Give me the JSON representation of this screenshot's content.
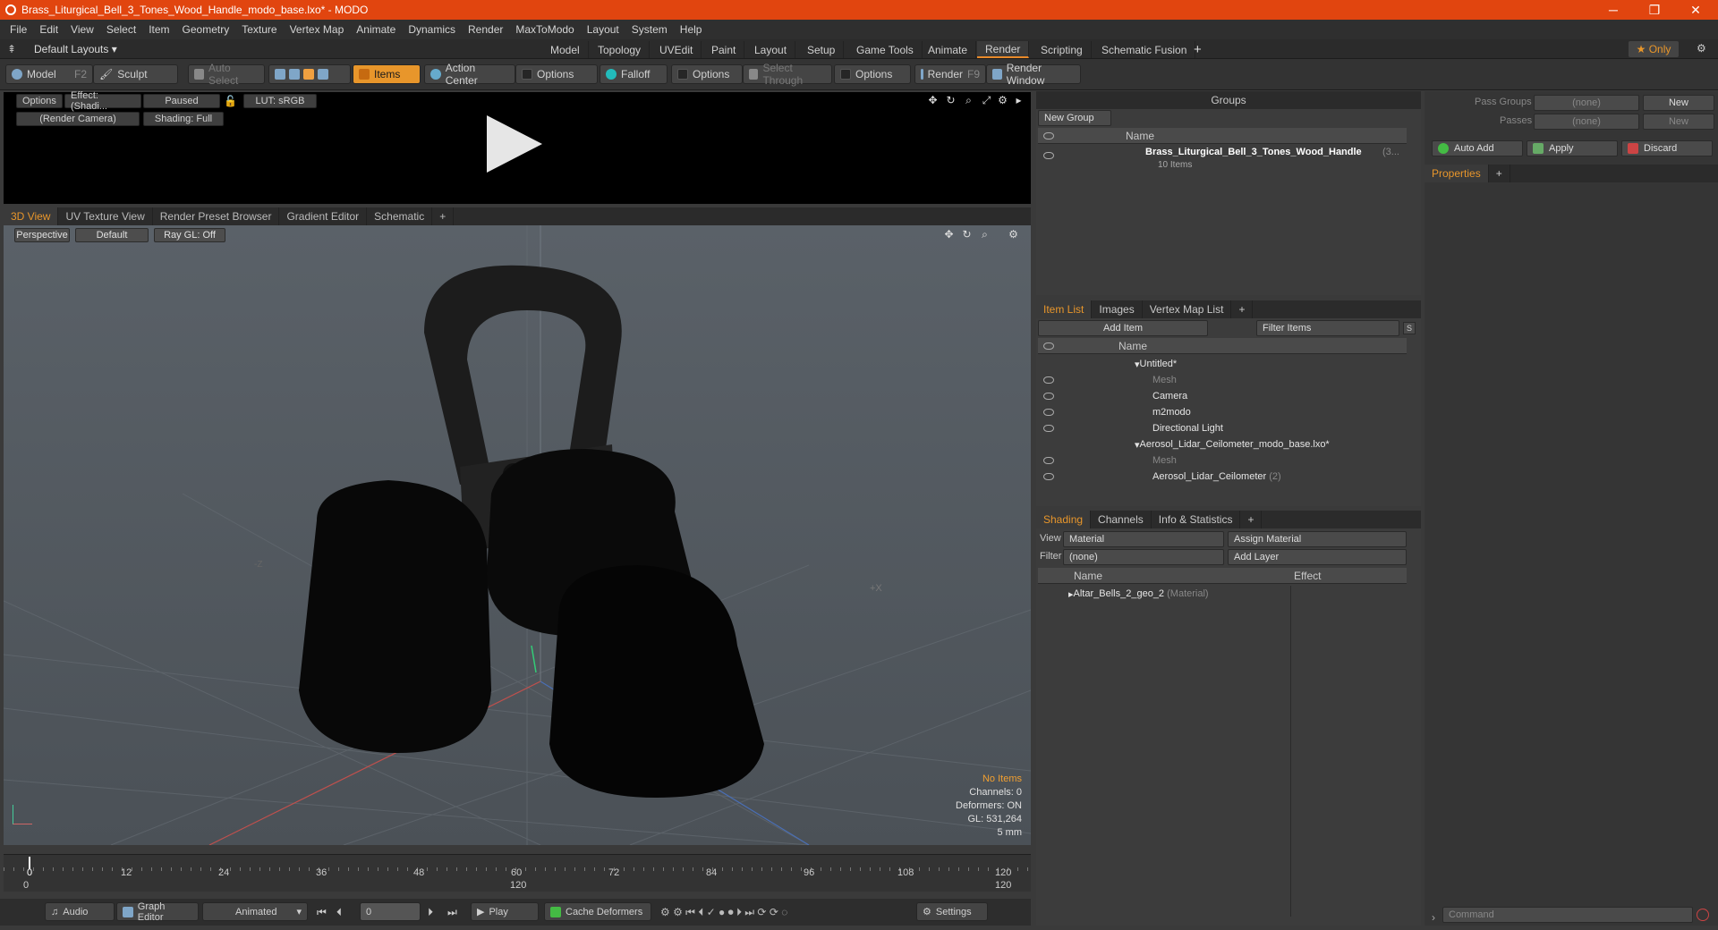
{
  "window": {
    "title": "Brass_Liturgical_Bell_3_Tones_Wood_Handle_modo_base.lxo* - MODO",
    "min": "─",
    "max": "❐",
    "close": "✕"
  },
  "menu": [
    "File",
    "Edit",
    "View",
    "Select",
    "Item",
    "Geometry",
    "Texture",
    "Vertex Map",
    "Animate",
    "Dynamics",
    "Render",
    "MaxToModo",
    "Layout",
    "System",
    "Help"
  ],
  "layouts": {
    "default_label": "Default Layouts ▾",
    "tabs": [
      "Model",
      "Topology",
      "UVEdit",
      "Paint",
      "Layout",
      "Setup",
      "Game Tools",
      "Animate",
      "Render",
      "Scripting",
      "Schematic Fusion"
    ],
    "active": "Render",
    "add": "+",
    "only": "★  Only"
  },
  "toolbar": {
    "model": "Model",
    "model_key": "F2",
    "sculpt": "Sculpt",
    "auto_select": "Auto Select",
    "items": "Items",
    "action_center": "Action Center",
    "options1": "Options",
    "falloff": "Falloff",
    "options2": "Options",
    "select_through": "Select Through",
    "options3": "Options",
    "render": "Render",
    "render_key": "F9",
    "render_window": "Render Window"
  },
  "render_panel": {
    "options": "Options",
    "effect": "Effect: (Shadi...",
    "paused": "Paused",
    "lut": "LUT: sRGB",
    "camera": "(Render Camera)",
    "shading": "Shading: Full"
  },
  "viewport_tabs": [
    "3D View",
    "UV Texture View",
    "Render Preset Browser",
    "Gradient Editor",
    "Schematic",
    "+"
  ],
  "viewport": {
    "perspective": "Perspective",
    "default": "Default",
    "raygl": "Ray GL: Off",
    "axis_z": "-Z",
    "axis_x": "+X",
    "info": {
      "no_items": "No Items",
      "channels": "Channels: 0",
      "deformers": "Deformers: ON",
      "gl": "GL: 531,264",
      "unit": "5 mm"
    }
  },
  "timeline": {
    "ticks": [
      "0",
      "12",
      "24",
      "36",
      "48",
      "60",
      "72",
      "84",
      "96",
      "108",
      "120"
    ],
    "sub_ticks": [
      "0",
      "120",
      "120"
    ]
  },
  "bottombar": {
    "audio": "Audio",
    "graph_editor": "Graph Editor",
    "animated": "Animated",
    "frame": "0",
    "play": "Play",
    "cache_deformers": "Cache Deformers",
    "settings": "Settings"
  },
  "groups": {
    "title": "Groups",
    "new_group": "New Group",
    "col_name": "Name",
    "item_name": "Brass_Liturgical_Bell_3_Tones_Wood_Handle",
    "item_suffix": "(3...",
    "item_count": "10 Items"
  },
  "item_list": {
    "tabs": [
      "Item List",
      "Images",
      "Vertex Map List",
      "+"
    ],
    "add_item": "Add Item",
    "filter": "Filter Items",
    "s": "S",
    "f": "F",
    "col_name": "Name",
    "rows": [
      {
        "label": "Untitled*",
        "dim": false
      },
      {
        "label": "Mesh",
        "dim": true
      },
      {
        "label": "Camera",
        "dim": false
      },
      {
        "label": "m2modo",
        "dim": false
      },
      {
        "label": "Directional Light",
        "dim": false
      },
      {
        "label": "Aerosol_Lidar_Ceilometer_modo_base.lxo*",
        "dim": false
      },
      {
        "label": "Mesh",
        "dim": true
      },
      {
        "label": "Aerosol_Lidar_Ceilometer",
        "dim": false,
        "suffix": "(2)"
      }
    ]
  },
  "shading": {
    "tabs": [
      "Shading",
      "Channels",
      "Info & Statistics",
      "+"
    ],
    "view_label": "View",
    "view_value": "Material",
    "assign": "Assign Material",
    "filter_label": "Filter",
    "filter_value": "(none)",
    "add_layer": "Add Layer",
    "col_name": "Name",
    "col_effect": "Effect",
    "row_name": "Altar_Bells_2_geo_2",
    "row_type": "(Material)"
  },
  "pass": {
    "pass_groups": "Pass Groups",
    "passes": "Passes",
    "none": "(none)",
    "new": "New",
    "auto_add": "Auto Add",
    "apply": "Apply",
    "discard": "Discard",
    "properties": "Properties",
    "add": "+"
  },
  "command": {
    "placeholder": "Command"
  }
}
